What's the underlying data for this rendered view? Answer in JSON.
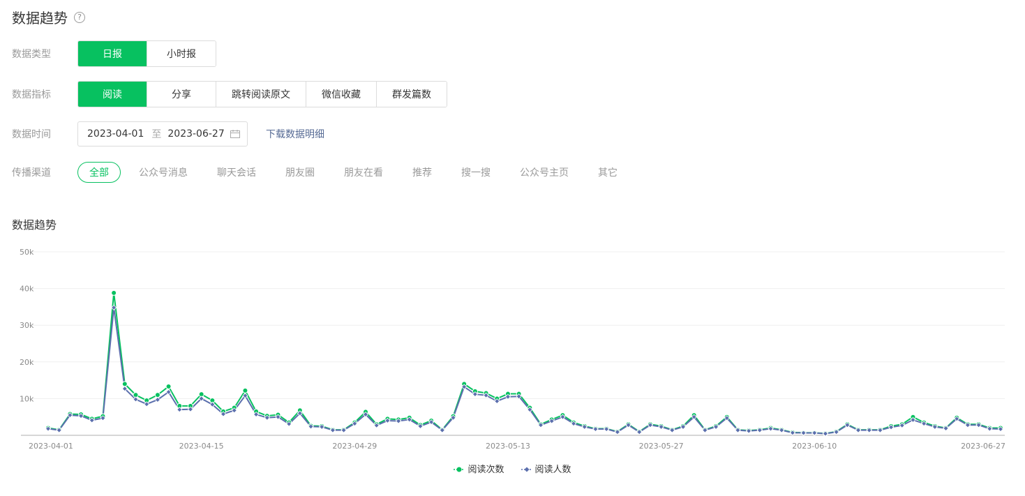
{
  "header": {
    "title": "数据趋势",
    "help_icon": "question-circle-icon"
  },
  "data_type": {
    "label": "数据类型",
    "options": [
      "日报",
      "小时报"
    ],
    "selected": "日报"
  },
  "data_metric": {
    "label": "数据指标",
    "options": [
      "阅读",
      "分享",
      "跳转阅读原文",
      "微信收藏",
      "群发篇数"
    ],
    "selected": "阅读"
  },
  "data_time": {
    "label": "数据时间",
    "start": "2023-04-01",
    "separator": "至",
    "end": "2023-06-27",
    "calendar_icon": "calendar-icon",
    "download_label": "下载数据明细"
  },
  "channel": {
    "label": "传播渠道",
    "options": [
      "全部",
      "公众号消息",
      "聊天会话",
      "朋友圈",
      "朋友在看",
      "推荐",
      "搜一搜",
      "公众号主页",
      "其它"
    ],
    "selected": "全部"
  },
  "chart_section_title": "数据趋势",
  "colors": {
    "accent": "#07c160",
    "series_reads": "#07c160",
    "series_readers": "#5b6fad",
    "link": "#576b95"
  },
  "chart_data": {
    "type": "line",
    "ylim": [
      0,
      50000
    ],
    "yticks": [
      "0",
      "10k",
      "20k",
      "30k",
      "40k",
      "50k"
    ],
    "xtick_labels": [
      "2023-04-01",
      "2023-04-15",
      "2023-04-29",
      "2023-05-13",
      "2023-05-27",
      "2023-06-10",
      "2023-06-27"
    ],
    "xtick_indices": [
      0,
      14,
      28,
      42,
      56,
      70,
      87
    ],
    "grid": true,
    "legend_position": "bottom-center",
    "series": [
      {
        "name": "阅读次数",
        "color": "#07c160",
        "values": [
          2000,
          1500,
          5800,
          5700,
          4500,
          5200,
          38800,
          14000,
          11000,
          9500,
          11000,
          13300,
          8000,
          8000,
          11200,
          9500,
          6500,
          7500,
          12200,
          6500,
          5300,
          5600,
          3500,
          6800,
          2600,
          2500,
          1500,
          1500,
          3500,
          6400,
          3000,
          4500,
          4300,
          4800,
          2800,
          4000,
          1500,
          5200,
          14000,
          12000,
          11500,
          10000,
          11300,
          11300,
          7500,
          3000,
          4300,
          5500,
          3500,
          2500,
          1800,
          1800,
          1000,
          3000,
          1000,
          3000,
          2500,
          1500,
          2500,
          5500,
          1500,
          2500,
          5000,
          1500,
          1300,
          1500,
          2000,
          1500,
          800,
          700,
          700,
          500,
          1000,
          3000,
          1500,
          1500,
          1500,
          2500,
          3000,
          5000,
          3500,
          2500,
          2000,
          4800,
          3000,
          3000,
          2000,
          2000
        ]
      },
      {
        "name": "阅读人数",
        "color": "#5b6fad",
        "values": [
          1800,
          1400,
          5500,
          5300,
          4100,
          4700,
          34800,
          12700,
          9800,
          8500,
          9700,
          11800,
          7000,
          7100,
          10000,
          8400,
          5800,
          6800,
          10800,
          5700,
          4800,
          5000,
          3100,
          6000,
          2400,
          2300,
          1400,
          1400,
          3200,
          5700,
          2700,
          4000,
          3900,
          4300,
          2500,
          3600,
          1400,
          4800,
          13200,
          11200,
          10900,
          9300,
          10500,
          10600,
          7000,
          2800,
          3900,
          5000,
          3200,
          2300,
          1700,
          1700,
          900,
          2800,
          900,
          2800,
          2300,
          1400,
          2300,
          5000,
          1400,
          2300,
          4700,
          1400,
          1200,
          1400,
          1800,
          1400,
          700,
          650,
          650,
          450,
          900,
          2800,
          1400,
          1400,
          1400,
          2200,
          2700,
          4200,
          3200,
          2300,
          1900,
          4500,
          2800,
          2800,
          1800,
          1700
        ]
      }
    ]
  }
}
